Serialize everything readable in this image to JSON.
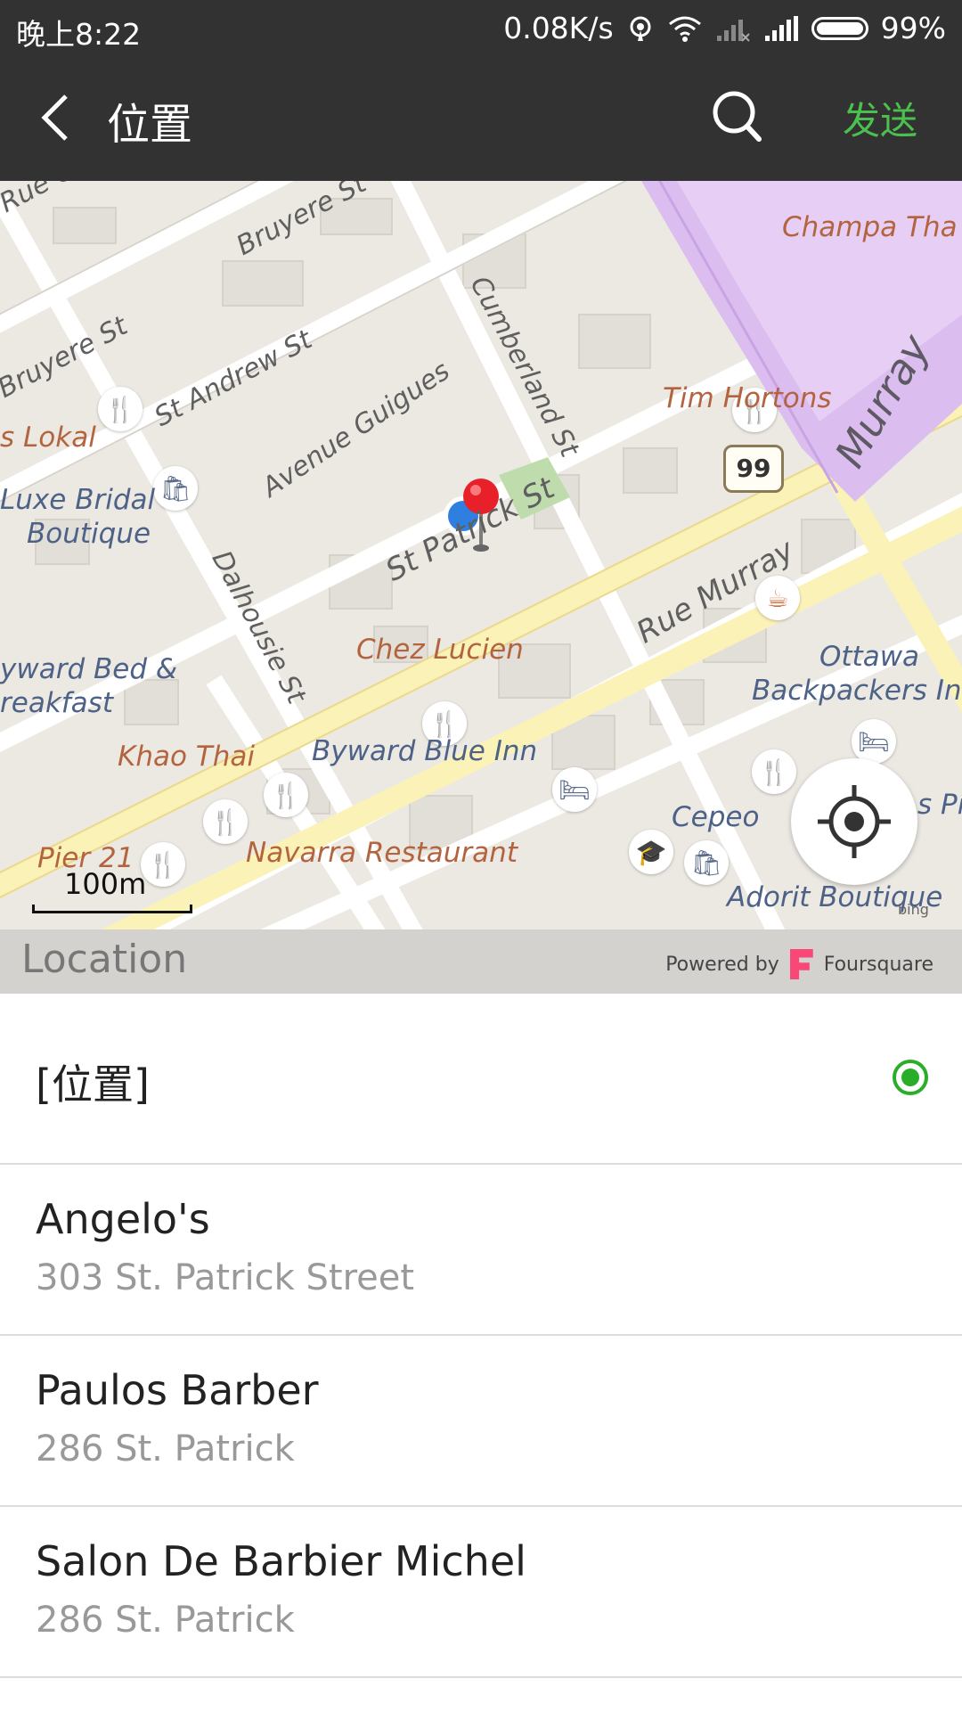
{
  "status_bar": {
    "time": "晚上8:22",
    "speed": "0.08K/s",
    "battery": "99%"
  },
  "header": {
    "title": "位置",
    "send_label": "发送",
    "icons": [
      "back-arrow-icon",
      "search-icon"
    ]
  },
  "map": {
    "streets": [
      "Bruyere St",
      "Bruyere St",
      "St Andrew St",
      "Avenue Guigues",
      "Cumberland St",
      "Dalhousie St",
      "St Patrick St",
      "Rue Murray",
      "Murray",
      "Rue Cat"
    ],
    "pois": {
      "champa": "Champa Tha",
      "tim_hortons": "Tim Hortons",
      "lokal": "s Lokal",
      "luxe_bridal_1": "Luxe Bridal",
      "luxe_bridal_2": "Boutique",
      "chez_lucien": "Chez Lucien",
      "byward_bed_1": "yward Bed &",
      "byward_bed_2": "reakfast",
      "ottawa_backpackers_1": "Ottawa",
      "ottawa_backpackers_2": "Backpackers In",
      "khao_thai": "Khao Thai",
      "byward_blue_inn": "Byward Blue Inn",
      "cepeo": "Cepeo",
      "s_pi": "s Pi",
      "pier21": "Pier 21",
      "navarra": "Navarra Restaurant",
      "adorit": "Adorit Boutique"
    },
    "route_shield": "99",
    "scale_label": "100m",
    "attribution": "bing"
  },
  "location_bar": {
    "label": "Location",
    "powered_by": "Powered by",
    "provider": "Foursquare"
  },
  "places": [
    {
      "name": "[位置]",
      "address": "",
      "selected": true
    },
    {
      "name": "Angelo's",
      "address": "303 St. Patrick Street",
      "selected": false
    },
    {
      "name": "Paulos Barber",
      "address": "286 St. Patrick",
      "selected": false
    },
    {
      "name": "Salon De Barbier Michel",
      "address": "286 St. Patrick",
      "selected": false
    }
  ],
  "colors": {
    "header_bg": "#323232",
    "accent_green": "#4bc04e",
    "radio_green": "#2aae2a",
    "pin_red": "#e8202a",
    "my_location_blue": "#2f7fe0"
  }
}
